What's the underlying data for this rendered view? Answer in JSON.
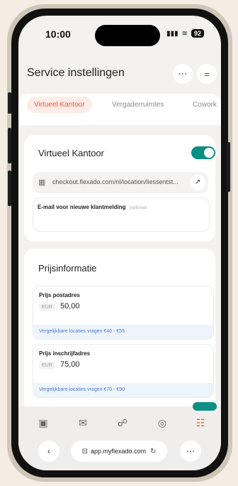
{
  "status_bar": {
    "time": "10:00",
    "battery": "92"
  },
  "header": {
    "title": "Service instellingen"
  },
  "tabs": [
    {
      "label": "Virtueel Kantoor",
      "active": true
    },
    {
      "label": "Vergaderruimtes",
      "active": false
    },
    {
      "label": "Cowork",
      "active": false
    }
  ],
  "virtual_office": {
    "title": "Virtueel Kantoor",
    "enabled": true,
    "checkout_url": "checkout.flexado.com/nl/location/liessentst...",
    "email_label": "E-mail voor nieuwe klantmelding",
    "email_optional": "(optional)",
    "email_value": ""
  },
  "pricing": {
    "title": "Prijsinformatie",
    "items": [
      {
        "label": "Prijs postadres",
        "currency": "EUR",
        "value": "50,00",
        "note": "Vergelijkbare locaties vragen €40 - €55"
      },
      {
        "label": "Prijs inschrijfadres",
        "currency": "EUR",
        "value": "75,00",
        "note": "Vergelijkbare locaties vragen €70 - €90"
      }
    ]
  },
  "browser": {
    "address": "app.myflexado.com"
  },
  "colors": {
    "accent": "#e85a3a",
    "toggle": "#0a8f84",
    "note": "#4a7fd1"
  },
  "icons": {
    "nav": [
      "inbox-icon",
      "mail-icon",
      "users-icon",
      "location-icon",
      "services-icon"
    ],
    "header": [
      "chat-icon",
      "menu-icon"
    ]
  }
}
